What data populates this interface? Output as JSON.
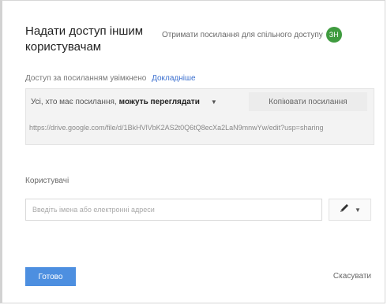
{
  "dialog": {
    "title": "Надати доступ іншим користувачам",
    "advanced_link": "Отримати посилання для спільного доступу",
    "avatar_initials": "ЗН"
  },
  "link_section": {
    "access_label": "Доступ за посиланням увімкнено",
    "more_link": "Докладніше",
    "permission_prefix": "Усі, хто має посилання,",
    "permission_level": "можуть переглядати",
    "copy_button": "Копіювати посилання",
    "url": "https://drive.google.com/file/d/1BkHVlVbK2AS2t0Q6tQ8ecXa2LaN9mnwYw/edit?usp=sharing"
  },
  "people_section": {
    "label": "Користувачі",
    "placeholder": "Введіть імена або електронні адреси"
  },
  "footer": {
    "done_button": "Готово",
    "cancel_link": "Скасувати"
  },
  "colors": {
    "accent": "#4d8fe0",
    "avatar": "#3f9b3f",
    "link": "#3b6fcf"
  },
  "icons": {
    "edit": "pencil-icon",
    "dropdown": "chevron-down-icon"
  }
}
